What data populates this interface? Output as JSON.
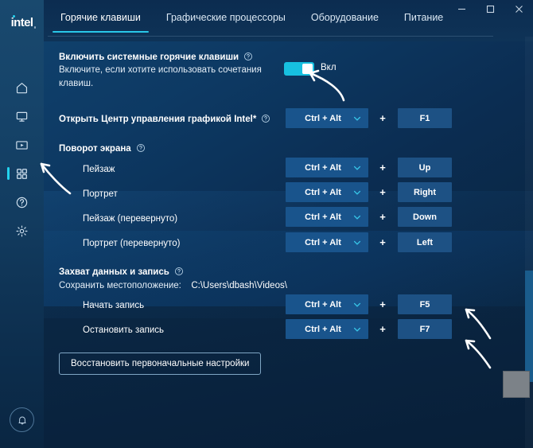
{
  "window": {
    "brand": "intel",
    "controls": [
      {
        "name": "minimize",
        "glyph": "minimize-icon"
      },
      {
        "name": "maximize",
        "glyph": "maximize-icon"
      },
      {
        "name": "close",
        "glyph": "close-icon"
      }
    ]
  },
  "sidebar": {
    "items": [
      {
        "id": "home",
        "icon": "home-icon",
        "active": false
      },
      {
        "id": "display",
        "icon": "monitor-icon",
        "active": false
      },
      {
        "id": "video",
        "icon": "video-icon",
        "active": false
      },
      {
        "id": "apps",
        "icon": "grid-apps-icon",
        "active": true
      },
      {
        "id": "support",
        "icon": "help-icon",
        "active": false
      },
      {
        "id": "system",
        "icon": "gear-icon",
        "active": false
      }
    ],
    "notification_icon": "bell-icon"
  },
  "tabs": [
    {
      "id": "hotkeys",
      "label": "Горячие клавиши",
      "active": true
    },
    {
      "id": "gpus",
      "label": "Графические процессоры",
      "active": false
    },
    {
      "id": "hardware",
      "label": "Оборудование",
      "active": false
    },
    {
      "id": "power",
      "label": "Питание",
      "active": false
    }
  ],
  "main": {
    "enable_section": {
      "title": "Включить системные горячие клавиши",
      "description_line1": "Включите, если хотите использовать сочетания",
      "description_line2": "клавиш.",
      "toggle_state_label": "Вкл",
      "toggle_on": true,
      "help_icon": "question-circle-icon"
    },
    "open_igcc": {
      "label": "Открыть Центр управления графикой Intel*",
      "help_icon": "question-circle-icon",
      "modifier": "Ctrl + Alt",
      "separator": "+",
      "key": "F1"
    },
    "rotation_section": {
      "title": "Поворот экрана",
      "help_icon": "question-circle-icon",
      "rows": [
        {
          "label": "Пейзаж",
          "modifier": "Ctrl + Alt",
          "separator": "+",
          "key": "Up"
        },
        {
          "label": "Портрет",
          "modifier": "Ctrl + Alt",
          "separator": "+",
          "key": "Right"
        },
        {
          "label": "Пейзаж (перевернуто)",
          "modifier": "Ctrl + Alt",
          "separator": "+",
          "key": "Down"
        },
        {
          "label": "Портрет (перевернуто)",
          "modifier": "Ctrl + Alt",
          "separator": "+",
          "key": "Left"
        }
      ]
    },
    "capture_section": {
      "title": "Захват данных и запись",
      "help_icon": "question-circle-icon",
      "save_location_label": "Сохранить местоположение:",
      "save_location_value": "C:\\Users\\dbash\\Videos\\",
      "rows": [
        {
          "label": "Начать запись",
          "modifier": "Ctrl + Alt",
          "separator": "+",
          "key": "F5"
        },
        {
          "label": "Остановить запись",
          "modifier": "Ctrl + Alt",
          "separator": "+",
          "key": "F7"
        }
      ]
    },
    "restore_button_label": "Восстановить первоначальные настройки"
  },
  "colors": {
    "accent_cyan": "#29c7e8",
    "toggle_on": "#17c0e0",
    "dropdown_bg": "#19548c",
    "key_button_bg": "#1d5184",
    "page_bg": "#0b2443",
    "sidebar_top": "#19496e",
    "annotation_arrow": "#ffffff"
  }
}
